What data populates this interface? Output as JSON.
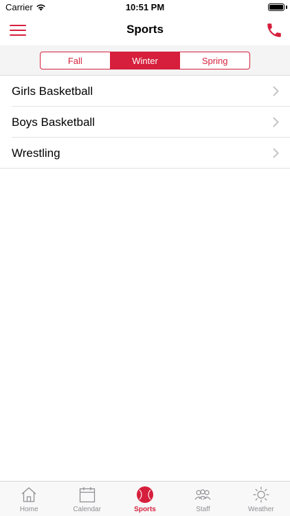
{
  "status_bar": {
    "carrier": "Carrier",
    "time": "10:51 PM"
  },
  "nav": {
    "title": "Sports",
    "menu_icon": "hamburger-menu-icon",
    "phone_icon": "phone-icon"
  },
  "segments": {
    "items": [
      {
        "label": "Fall"
      },
      {
        "label": "Winter"
      },
      {
        "label": "Spring"
      }
    ],
    "selected": "Winter"
  },
  "sports": [
    {
      "label": "Girls Basketball"
    },
    {
      "label": "Boys Basketball"
    },
    {
      "label": "Wrestling"
    }
  ],
  "tabs": [
    {
      "label": "Home",
      "icon": "home-icon"
    },
    {
      "label": "Calendar",
      "icon": "calendar-icon"
    },
    {
      "label": "Sports",
      "icon": "ball-icon"
    },
    {
      "label": "Staff",
      "icon": "people-icon"
    },
    {
      "label": "Weather",
      "icon": "sun-icon"
    }
  ],
  "active_tab": "Sports",
  "colors": {
    "accent": "#d61f3c",
    "inactive": "#8e8e93"
  }
}
